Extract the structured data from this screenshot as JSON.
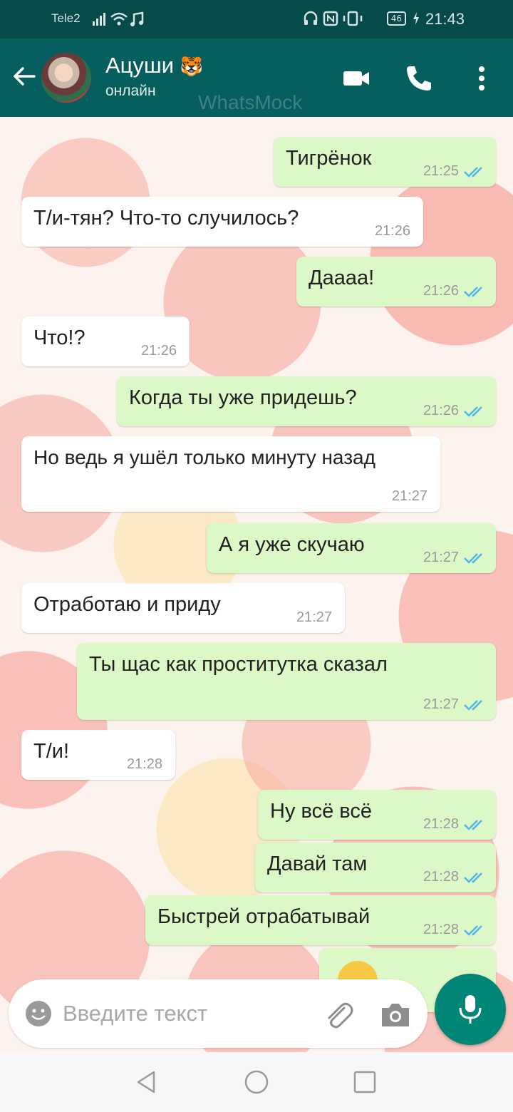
{
  "status_bar": {
    "carrier": "Tele2",
    "battery": "46",
    "time": "21:43"
  },
  "header": {
    "contact_name": "Ацуши",
    "contact_emoji": "🐯",
    "contact_status": "онлайн",
    "watermark": "WhatsMock",
    "icons": [
      "back-arrow-icon",
      "video-call-icon",
      "phone-icon",
      "more-options-icon"
    ]
  },
  "messages": [
    {
      "dir": "out",
      "text": "Тигрёнок",
      "time": "21:25"
    },
    {
      "dir": "in",
      "text": "Т/и-тян? Что-то случилось?",
      "time": "21:26"
    },
    {
      "dir": "out",
      "text": "Даaaa!",
      "time": "21:26"
    },
    {
      "dir": "in",
      "text": "Что!?",
      "time": "21:26"
    },
    {
      "dir": "out",
      "text": "Когда ты уже придешь?",
      "time": "21:26"
    },
    {
      "dir": "in",
      "text": "Но ведь я ушёл только минуту назад",
      "time": "21:27"
    },
    {
      "dir": "out",
      "text": "А я уже скучаю",
      "time": "21:27"
    },
    {
      "dir": "in",
      "text": "Отработаю и приду",
      "time": "21:27"
    },
    {
      "dir": "out",
      "text": "Ты щас как проститутка сказал",
      "time": "21:27"
    },
    {
      "dir": "in",
      "text": "Т/и!",
      "time": "21:28"
    },
    {
      "dir": "out",
      "text": "Ну всё всё",
      "time": "21:28"
    },
    {
      "dir": "out",
      "text": "Давай там",
      "time": "21:28"
    },
    {
      "dir": "out",
      "text": "Быстрей отрабатывай",
      "time": "21:28"
    },
    {
      "dir": "out",
      "text": "",
      "time": ""
    }
  ],
  "composer": {
    "placeholder": "Введите текст",
    "icons": [
      "emoji-icon",
      "attach-icon",
      "camera-icon",
      "mic-icon"
    ]
  },
  "colors": {
    "status_bar": "#064a4a",
    "app_bar": "#075e5e",
    "outgoing_bubble": "#dcf8c6",
    "incoming_bubble": "#ffffff",
    "read_ticks": "#4fb6ec",
    "mic_button": "#008577"
  }
}
